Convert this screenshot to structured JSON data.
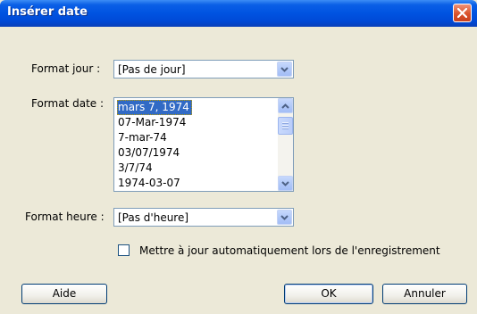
{
  "window": {
    "title": "Insérer date"
  },
  "form": {
    "day_format": {
      "label": "Format jour :",
      "value": "[Pas de jour]"
    },
    "date_format": {
      "label": "Format date :",
      "options": [
        "mars 7, 1974",
        "07-Mar-1974",
        "7-mar-74",
        "03/07/1974",
        "3/7/74",
        "1974-03-07"
      ],
      "selected": "mars 7, 1974"
    },
    "time_format": {
      "label": "Format heure :",
      "value": "[Pas d'heure]"
    },
    "auto_update": {
      "label": "Mettre à jour automatiquement lors de l'enregistrement",
      "checked": false
    }
  },
  "buttons": {
    "help": "Aide",
    "ok": "OK",
    "cancel": "Annuler"
  },
  "colors": {
    "titlebar": "#0053e1",
    "close": "#d9532c",
    "selection": "#316ac5",
    "dialog_bg": "#ece9d8"
  }
}
